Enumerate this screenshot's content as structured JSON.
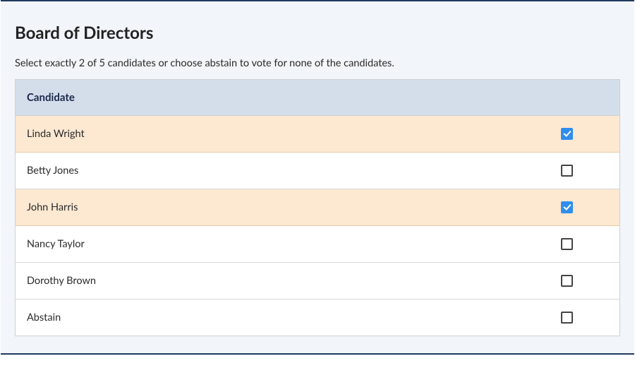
{
  "title": "Board of Directors",
  "instructions": "Select exactly 2 of 5 candidates or choose abstain to vote for none of the candidates.",
  "column_header": "Candidate",
  "candidates": [
    {
      "name": "Linda Wright",
      "selected": true
    },
    {
      "name": "Betty Jones",
      "selected": false
    },
    {
      "name": "John Harris",
      "selected": true
    },
    {
      "name": "Nancy Taylor",
      "selected": false
    },
    {
      "name": "Dorothy Brown",
      "selected": false
    },
    {
      "name": "Abstain",
      "selected": false
    }
  ]
}
